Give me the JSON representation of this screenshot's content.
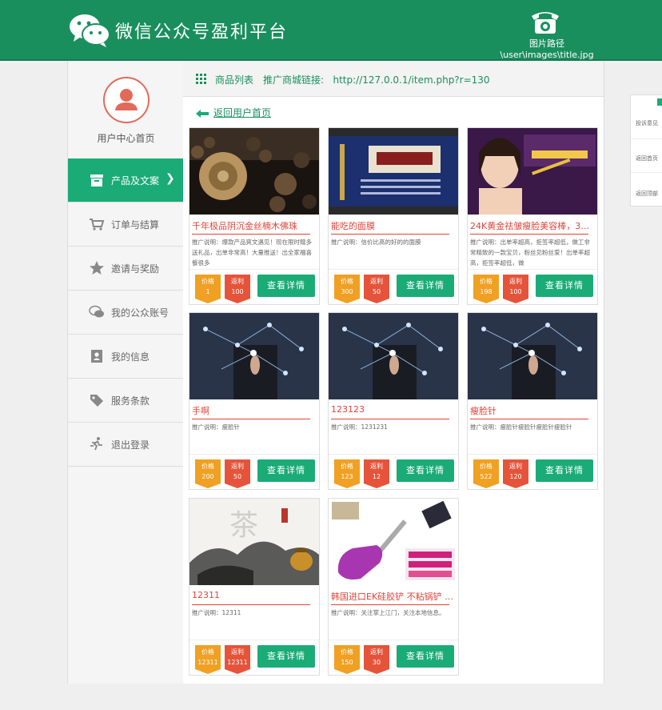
{
  "header": {
    "title": "微信公众号盈利平台",
    "image_path": "图片路径 \\user\\images\\title.jpg",
    "bg_color": "#1a8f5e"
  },
  "sidebar": {
    "user_center": "用户中心首页",
    "items": [
      {
        "label": "产品及文案",
        "icon": "box-icon",
        "active": true,
        "arrow": "❯"
      },
      {
        "label": "订单与结算",
        "icon": "cart-icon",
        "active": false
      },
      {
        "label": "邀请与奖励",
        "icon": "star-icon",
        "active": false
      },
      {
        "label": "我的公众账号",
        "icon": "wechat-icon",
        "active": false
      },
      {
        "label": "我的信息",
        "icon": "contact-card-icon",
        "active": false
      },
      {
        "label": "服务条款",
        "icon": "tag-icon",
        "active": false
      },
      {
        "label": "退出登录",
        "icon": "runner-icon",
        "active": false
      }
    ]
  },
  "topbar": {
    "list_label": "商品列表",
    "promo_link": "推广商城链接:   http://127.0.0.1/item.php?r=130"
  },
  "back_link": "返回用户首页",
  "card_labels": {
    "price": "价格",
    "rebate": "返利",
    "detail": "查看详情"
  },
  "products": [
    {
      "name": "千年极品阴沉金丝楠木佛珠",
      "desc": "推广说明：爆款产品爽文遇见！现在限时赠多送礼品，出单非常高！大量推送！出全家福喜餐很多",
      "price": "1",
      "rebate": "100",
      "image": "prayer-beads"
    },
    {
      "name": "能吃的面膜",
      "desc": "推广说明：信价比高的好的的面膜",
      "price": "300",
      "rebate": "50",
      "image": "blue-brochure"
    },
    {
      "name": "24K黄金祛皱瘦脸美容棒，3分...",
      "desc": "推广说明：出单率超高，拒签率超低，做工非常精致的一款宝贝，粉丝见粉丝爱！出单率超高，拒签率超低，做",
      "price": "198",
      "rebate": "100",
      "image": "beauty-ad"
    },
    {
      "name": "手啊",
      "desc": "推广说明：瘦脸针",
      "price": "200",
      "rebate": "50",
      "image": "tech-hand"
    },
    {
      "name": "123123",
      "desc": "推广说明：1231231",
      "price": "123",
      "rebate": "12",
      "image": "tech-hand"
    },
    {
      "name": "瘦脸针",
      "desc": "推广说明：瘦脸针瘦脸针瘦脸针瘦脸针",
      "price": "522",
      "rebate": "120",
      "image": "tech-hand"
    },
    {
      "name": "12311",
      "desc": "推广说明：12311",
      "price": "12311",
      "rebate": "12311",
      "image": "tea-ink"
    },
    {
      "name": "韩国进口EK硅胶铲 不粘锅铲 天...",
      "desc": "推广说明：关注掌上江门，关注本地信息。",
      "price": "150",
      "rebate": "30",
      "image": "spatula"
    }
  ],
  "right_widget": {
    "items": [
      "投诉意见",
      "返回首页",
      "返回顶部"
    ]
  }
}
